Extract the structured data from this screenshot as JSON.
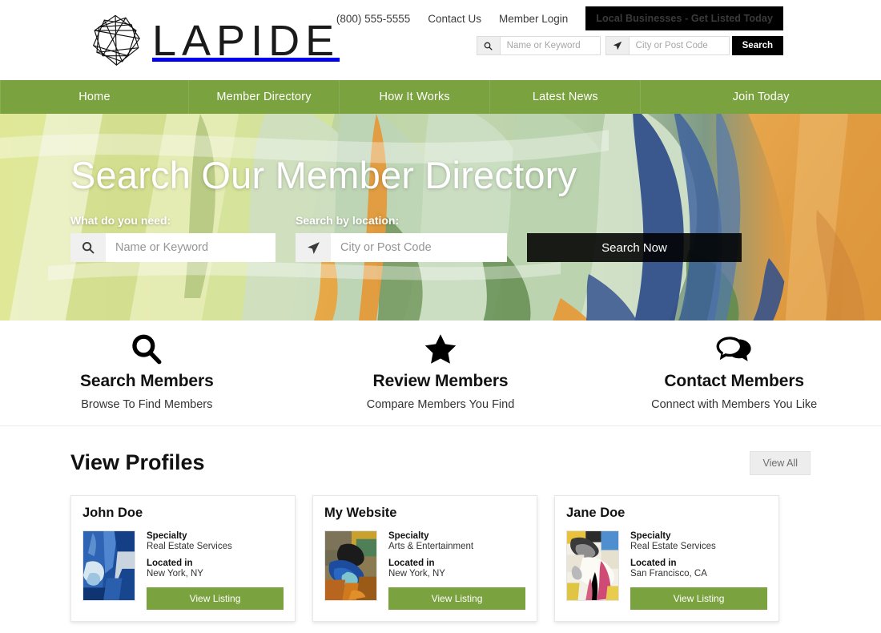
{
  "brand": {
    "name": "LAPIDE",
    "logo_icon": "polyhedron-wireframe-icon"
  },
  "header": {
    "phone": "(800) 555-5555",
    "contact_label": "Contact Us",
    "login_label": "Member Login",
    "cta_label": "Local Businesses - Get Listed Today",
    "search": {
      "keyword_placeholder": "Name or Keyword",
      "keyword_value": "",
      "location_placeholder": "City or Post Code",
      "location_value": "",
      "submit_label": "Search",
      "keyword_icon": "search-icon",
      "location_icon": "location-arrow-icon"
    }
  },
  "nav": {
    "items": [
      {
        "label": "Home"
      },
      {
        "label": "Member Directory"
      },
      {
        "label": "How It Works"
      },
      {
        "label": "Latest News"
      },
      {
        "label": "Join Today"
      }
    ]
  },
  "hero": {
    "title": "Search Our Member Directory",
    "keyword_label": "What do you need:",
    "keyword_placeholder": "Name or Keyword",
    "keyword_value": "",
    "location_label": "Search by location:",
    "location_placeholder": "City or Post Code",
    "location_value": "",
    "submit_label": "Search Now",
    "keyword_icon": "search-icon",
    "location_icon": "location-arrow-icon"
  },
  "features": [
    {
      "icon": "magnifier-icon",
      "title": "Search Members",
      "subtitle": "Browse To Find Members"
    },
    {
      "icon": "star-icon",
      "title": "Review Members",
      "subtitle": "Compare Members You Find"
    },
    {
      "icon": "chat-bubbles-icon",
      "title": "Contact Members",
      "subtitle": "Connect with Members You Like"
    }
  ],
  "profiles": {
    "title": "View Profiles",
    "view_all_label": "View All",
    "specialty_label": "Specialty",
    "located_label": "Located in",
    "listing_button_label": "View Listing",
    "cards": [
      {
        "name": "John Doe",
        "specialty": "Real Estate Services",
        "location": "New York, NY",
        "thumb_alt": "blue-abstract-painting"
      },
      {
        "name": "My Website",
        "specialty": "Arts & Entertainment",
        "location": "New York, NY",
        "thumb_alt": "blue-orange-abstract-painting"
      },
      {
        "name": "Jane Doe",
        "specialty": "Real Estate Services",
        "location": "San Francisco, CA",
        "thumb_alt": "pink-white-abstract-painting"
      }
    ]
  },
  "colors": {
    "brand_green": "#7aa23e",
    "black": "#000000",
    "text_dark": "#111111",
    "muted": "#9a9a9a"
  }
}
